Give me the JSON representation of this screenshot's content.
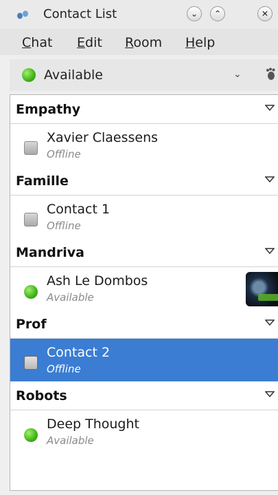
{
  "window": {
    "title": "Contact List"
  },
  "titlebar": {
    "minimize": "⌄",
    "maximize": "⌃",
    "close": "✕"
  },
  "menu": [
    {
      "accel": "C",
      "rest": "hat"
    },
    {
      "accel": "E",
      "rest": "dit"
    },
    {
      "accel": "R",
      "rest": "oom"
    },
    {
      "accel": "H",
      "rest": "elp"
    }
  ],
  "presence": {
    "label": "Available",
    "chevron": "⌄",
    "status_color": "#3fb21a"
  },
  "groups": [
    {
      "name": "Empathy",
      "contacts": [
        {
          "name": "Xavier Claessens",
          "status": "Offline",
          "online": false
        }
      ]
    },
    {
      "name": "Famille",
      "contacts": [
        {
          "name": "Contact 1",
          "status": "Offline",
          "online": false
        }
      ]
    },
    {
      "name": "Mandriva",
      "contacts": [
        {
          "name": "Ash Le Dombos",
          "status": "Available",
          "online": true,
          "has_avatar": true
        }
      ]
    },
    {
      "name": "Prof",
      "contacts": [
        {
          "name": "Contact 2",
          "status": "Offline",
          "online": false,
          "selected": true
        }
      ]
    },
    {
      "name": "Robots",
      "contacts": [
        {
          "name": "Deep Thought",
          "status": "Available",
          "online": true
        }
      ]
    }
  ],
  "colors": {
    "selection": "#3a7dd3",
    "available": "#3fb21a",
    "offline": "#a9a9a9"
  },
  "icons": {
    "app": "empathy-feet-icon",
    "group_toggle": "triangle-down-icon"
  }
}
